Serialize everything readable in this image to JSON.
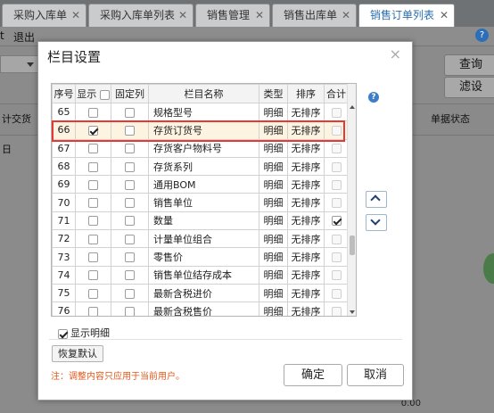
{
  "tabs": [
    {
      "label": "采购入库单",
      "active": false
    },
    {
      "label": "采购入库单列表",
      "active": false
    },
    {
      "label": "销售管理",
      "active": false
    },
    {
      "label": "销售出库单",
      "active": false
    },
    {
      "label": "销售订单列表",
      "active": true
    }
  ],
  "tab_close": "✕",
  "toolbar": {
    "exit_prefix": "t",
    "exit_label": "退出",
    "help": "?"
  },
  "background": {
    "query_button": "查询",
    "filter_button": "滤设",
    "col_left": "计交货日",
    "col_right": "单据状态",
    "bottom_value": "0.00"
  },
  "dialog": {
    "title": "栏目设置",
    "close": "×",
    "columns": {
      "no": "序号",
      "show": "显示",
      "fixed": "固定列",
      "name": "栏目名称",
      "type": "类型",
      "sort": "排序",
      "total": "合计"
    },
    "rows": [
      {
        "no": "65",
        "name": "规格型号",
        "type": "明细",
        "sort": "无排序",
        "show": false,
        "fixed": false,
        "total": false,
        "selected": false
      },
      {
        "no": "66",
        "name": "存货订货号",
        "type": "明细",
        "sort": "无排序",
        "show": true,
        "fixed": false,
        "total": false,
        "selected": true
      },
      {
        "no": "67",
        "name": "存货客户物料号",
        "type": "明细",
        "sort": "无排序",
        "show": false,
        "fixed": false,
        "total": false,
        "selected": false
      },
      {
        "no": "68",
        "name": "存货系列",
        "type": "明细",
        "sort": "无排序",
        "show": false,
        "fixed": false,
        "total": false,
        "selected": false
      },
      {
        "no": "69",
        "name": "通用BOM",
        "type": "明细",
        "sort": "无排序",
        "show": false,
        "fixed": false,
        "total": false,
        "selected": false
      },
      {
        "no": "70",
        "name": "销售单位",
        "type": "明细",
        "sort": "无排序",
        "show": false,
        "fixed": false,
        "total": false,
        "selected": false
      },
      {
        "no": "71",
        "name": "数量",
        "type": "明细",
        "sort": "无排序",
        "show": false,
        "fixed": false,
        "total": true,
        "selected": false
      },
      {
        "no": "72",
        "name": "计量单位组合",
        "type": "明细",
        "sort": "无排序",
        "show": false,
        "fixed": false,
        "total": false,
        "selected": false
      },
      {
        "no": "73",
        "name": "零售价",
        "type": "明细",
        "sort": "无排序",
        "show": false,
        "fixed": false,
        "total": false,
        "selected": false
      },
      {
        "no": "74",
        "name": "销售单位结存成本",
        "type": "明细",
        "sort": "无排序",
        "show": false,
        "fixed": false,
        "total": false,
        "selected": false
      },
      {
        "no": "75",
        "name": "最新含税进价",
        "type": "明细",
        "sort": "无排序",
        "show": false,
        "fixed": false,
        "total": false,
        "selected": false
      },
      {
        "no": "76",
        "name": "最新含税售价",
        "type": "明细",
        "sort": "无排序",
        "show": false,
        "fixed": false,
        "total": false,
        "selected": false
      }
    ],
    "help": "?",
    "show_detail_label": "显示明细",
    "show_detail_checked": true,
    "restore_default": "恢复默认",
    "note": "注：调整内容只应用于当前用户。",
    "ok": "确定",
    "cancel": "取消"
  },
  "colors": {
    "highlight_border": "#e53935",
    "note_text": "#e05a1e",
    "active_tab_text": "#2b6db0",
    "selected_row_bg": "#fdf3e1"
  }
}
